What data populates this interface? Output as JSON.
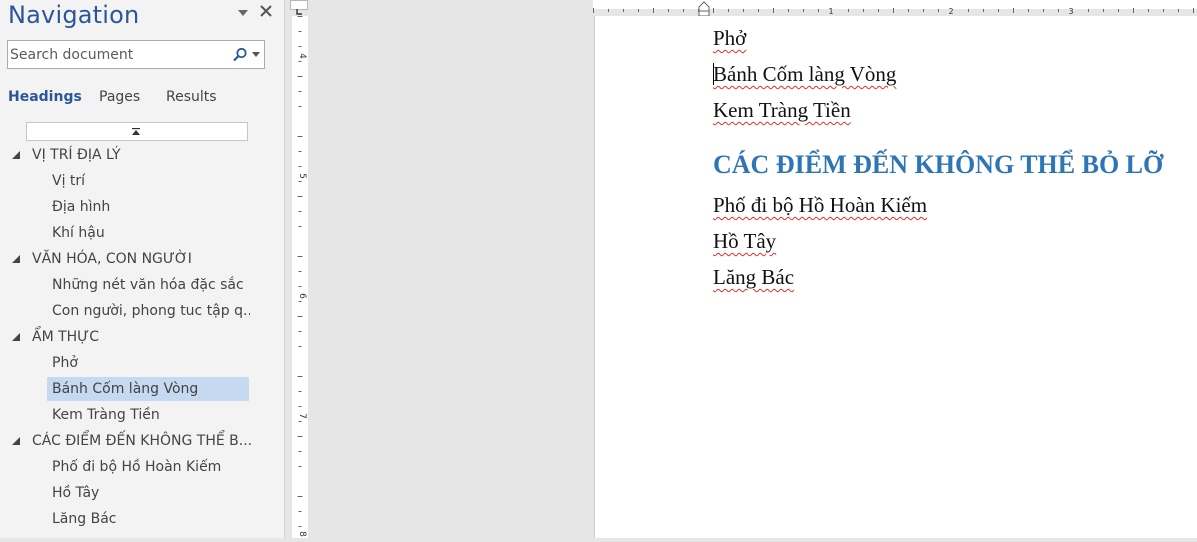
{
  "nav": {
    "title": "Navigation",
    "search_placeholder": "Search document",
    "tabs": [
      {
        "label": "Headings",
        "active": true
      },
      {
        "label": "Pages",
        "active": false
      },
      {
        "label": "Results",
        "active": false
      }
    ],
    "tree": [
      {
        "label": "VỊ TRÍ ĐỊA LÝ",
        "level": 1,
        "expanded": true
      },
      {
        "label": "Vị trí",
        "level": 2
      },
      {
        "label": "Địa hình",
        "level": 2
      },
      {
        "label": "Khí hậu",
        "level": 2
      },
      {
        "label": "VĂN HÓA, CON NGƯỜI",
        "level": 1,
        "expanded": true
      },
      {
        "label": "Những nét văn hóa đặc sắc",
        "level": 2
      },
      {
        "label": "Con người, phong tuc tập q...",
        "level": 2
      },
      {
        "label": "ẨM THỰC",
        "level": 1,
        "expanded": true
      },
      {
        "label": "Phở",
        "level": 2
      },
      {
        "label": "Bánh Cốm làng Vòng",
        "level": 2,
        "selected": true
      },
      {
        "label": "Kem Tràng Tiền",
        "level": 2
      },
      {
        "label": "CÁC ĐIỂM ĐẾN KHÔNG THỂ B...",
        "level": 1,
        "expanded": true
      },
      {
        "label": "Phố đi bộ Hồ Hoàn Kiếm",
        "level": 2
      },
      {
        "label": "Hồ Tây",
        "level": 2
      },
      {
        "label": "Lăng Bác",
        "level": 2
      }
    ]
  },
  "ruler": {
    "horizontal_numbers": [
      "1",
      "2",
      "3"
    ],
    "vertical_numbers": [
      "4",
      "5",
      "6",
      "7",
      "8"
    ]
  },
  "document": {
    "lines_before": [
      "Phở",
      "Bánh Cốm làng Vòng",
      "Kem Tràng Tiền"
    ],
    "heading": "CÁC ĐIỂM ĐẾN KHÔNG THỂ BỎ LỠ",
    "lines_after": [
      "Phố đi bộ Hồ Hoàn Kiếm",
      "Hồ Tây",
      "Lăng Bác"
    ]
  },
  "colors": {
    "accent": "#2b579a",
    "heading": "#2e75b6",
    "selection": "#c5d9f1",
    "spellcheck": "#e0302a"
  }
}
